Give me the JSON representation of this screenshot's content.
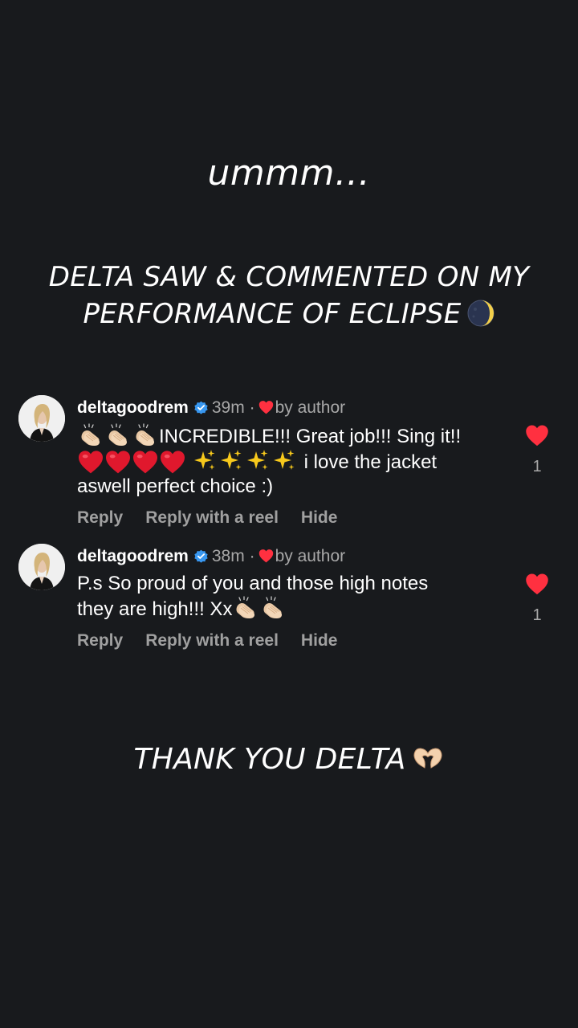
{
  "captions": {
    "intro": "ummm…",
    "headline_line1": "DELTA SAW & COMMENTED ON MY",
    "headline_line2": "PERFORMANCE OF ECLIPSE",
    "outro": "THANK YOU DELTA"
  },
  "icons": {
    "moon": "crescent-moon-icon",
    "heart_hands": "heart-hands-icon",
    "verified": "verified-badge-icon",
    "like": "heart-icon",
    "clap": "clapping-hands-icon",
    "sparkles": "sparkles-icon"
  },
  "colors": {
    "background": "#181a1d",
    "like_red": "#ff3040",
    "verified_blue": "#3897f0",
    "secondary_text": "#a8a8a8"
  },
  "comments": [
    {
      "username": "deltagoodrem",
      "time": "39m",
      "separator": "·",
      "liked_label": "by author",
      "text_a": "INCREDIBLE!!! Great job!!! Sing it!!",
      "text_b": " i love the jacket",
      "text_c": "aswell perfect choice :)",
      "likes": "1",
      "actions": {
        "reply": "Reply",
        "reply_reel": "Reply with a reel",
        "hide": "Hide"
      }
    },
    {
      "username": "deltagoodrem",
      "time": "38m",
      "separator": "·",
      "liked_label": "by author",
      "text_a": "P.s So proud of you and those high notes",
      "text_b": "they are high!!! Xx",
      "likes": "1",
      "actions": {
        "reply": "Reply",
        "reply_reel": "Reply with a reel",
        "hide": "Hide"
      }
    }
  ]
}
